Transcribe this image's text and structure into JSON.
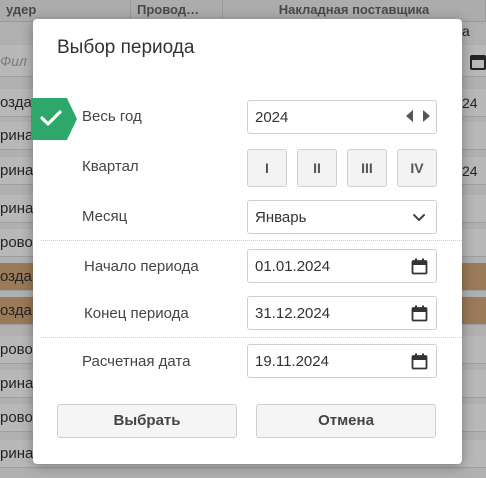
{
  "background": {
    "headers": [
      "удер",
      "Провод…",
      "Накладная поставщика"
    ],
    "filter_text": "Фил",
    "rows": [
      {
        "text": "озда",
        "highlight": false
      },
      {
        "text": "рина",
        "highlight": false
      },
      {
        "text": "рина",
        "highlight": false
      },
      {
        "text": "рина",
        "highlight": false
      },
      {
        "text": "рово",
        "highlight": false
      },
      {
        "text": "озда",
        "highlight": true
      },
      {
        "text": "озда",
        "highlight": true
      },
      {
        "text": "рово",
        "highlight": false
      },
      {
        "text": "рина",
        "highlight": false
      },
      {
        "text": "рово",
        "highlight": false
      },
      {
        "text": "рина",
        "highlight": false
      }
    ],
    "right_texts": {
      "r1": "а",
      "r2": "24",
      "r3": "24"
    }
  },
  "modal": {
    "title": "Выбор периода",
    "whole_year": {
      "label": "Весь год",
      "value": "2024",
      "checked": true
    },
    "quarter": {
      "label": "Квартал",
      "options": [
        "I",
        "II",
        "III",
        "IV"
      ]
    },
    "month": {
      "label": "Месяц",
      "value": "Январь"
    },
    "period_start": {
      "label": "Начало периода",
      "value": "01.01.2024"
    },
    "period_end": {
      "label": "Конец периода",
      "value": "31.12.2024"
    },
    "calc_date": {
      "label": "Расчетная дата",
      "value": "19.11.2024"
    },
    "buttons": {
      "select": "Выбрать",
      "cancel": "Отмена"
    }
  },
  "colors": {
    "check": "#2ea86a",
    "highlight_row": "#d6a97b"
  },
  "icons": [
    "check-icon",
    "prev-year-icon",
    "next-year-icon",
    "chevron-down-icon",
    "calendar-icon"
  ]
}
